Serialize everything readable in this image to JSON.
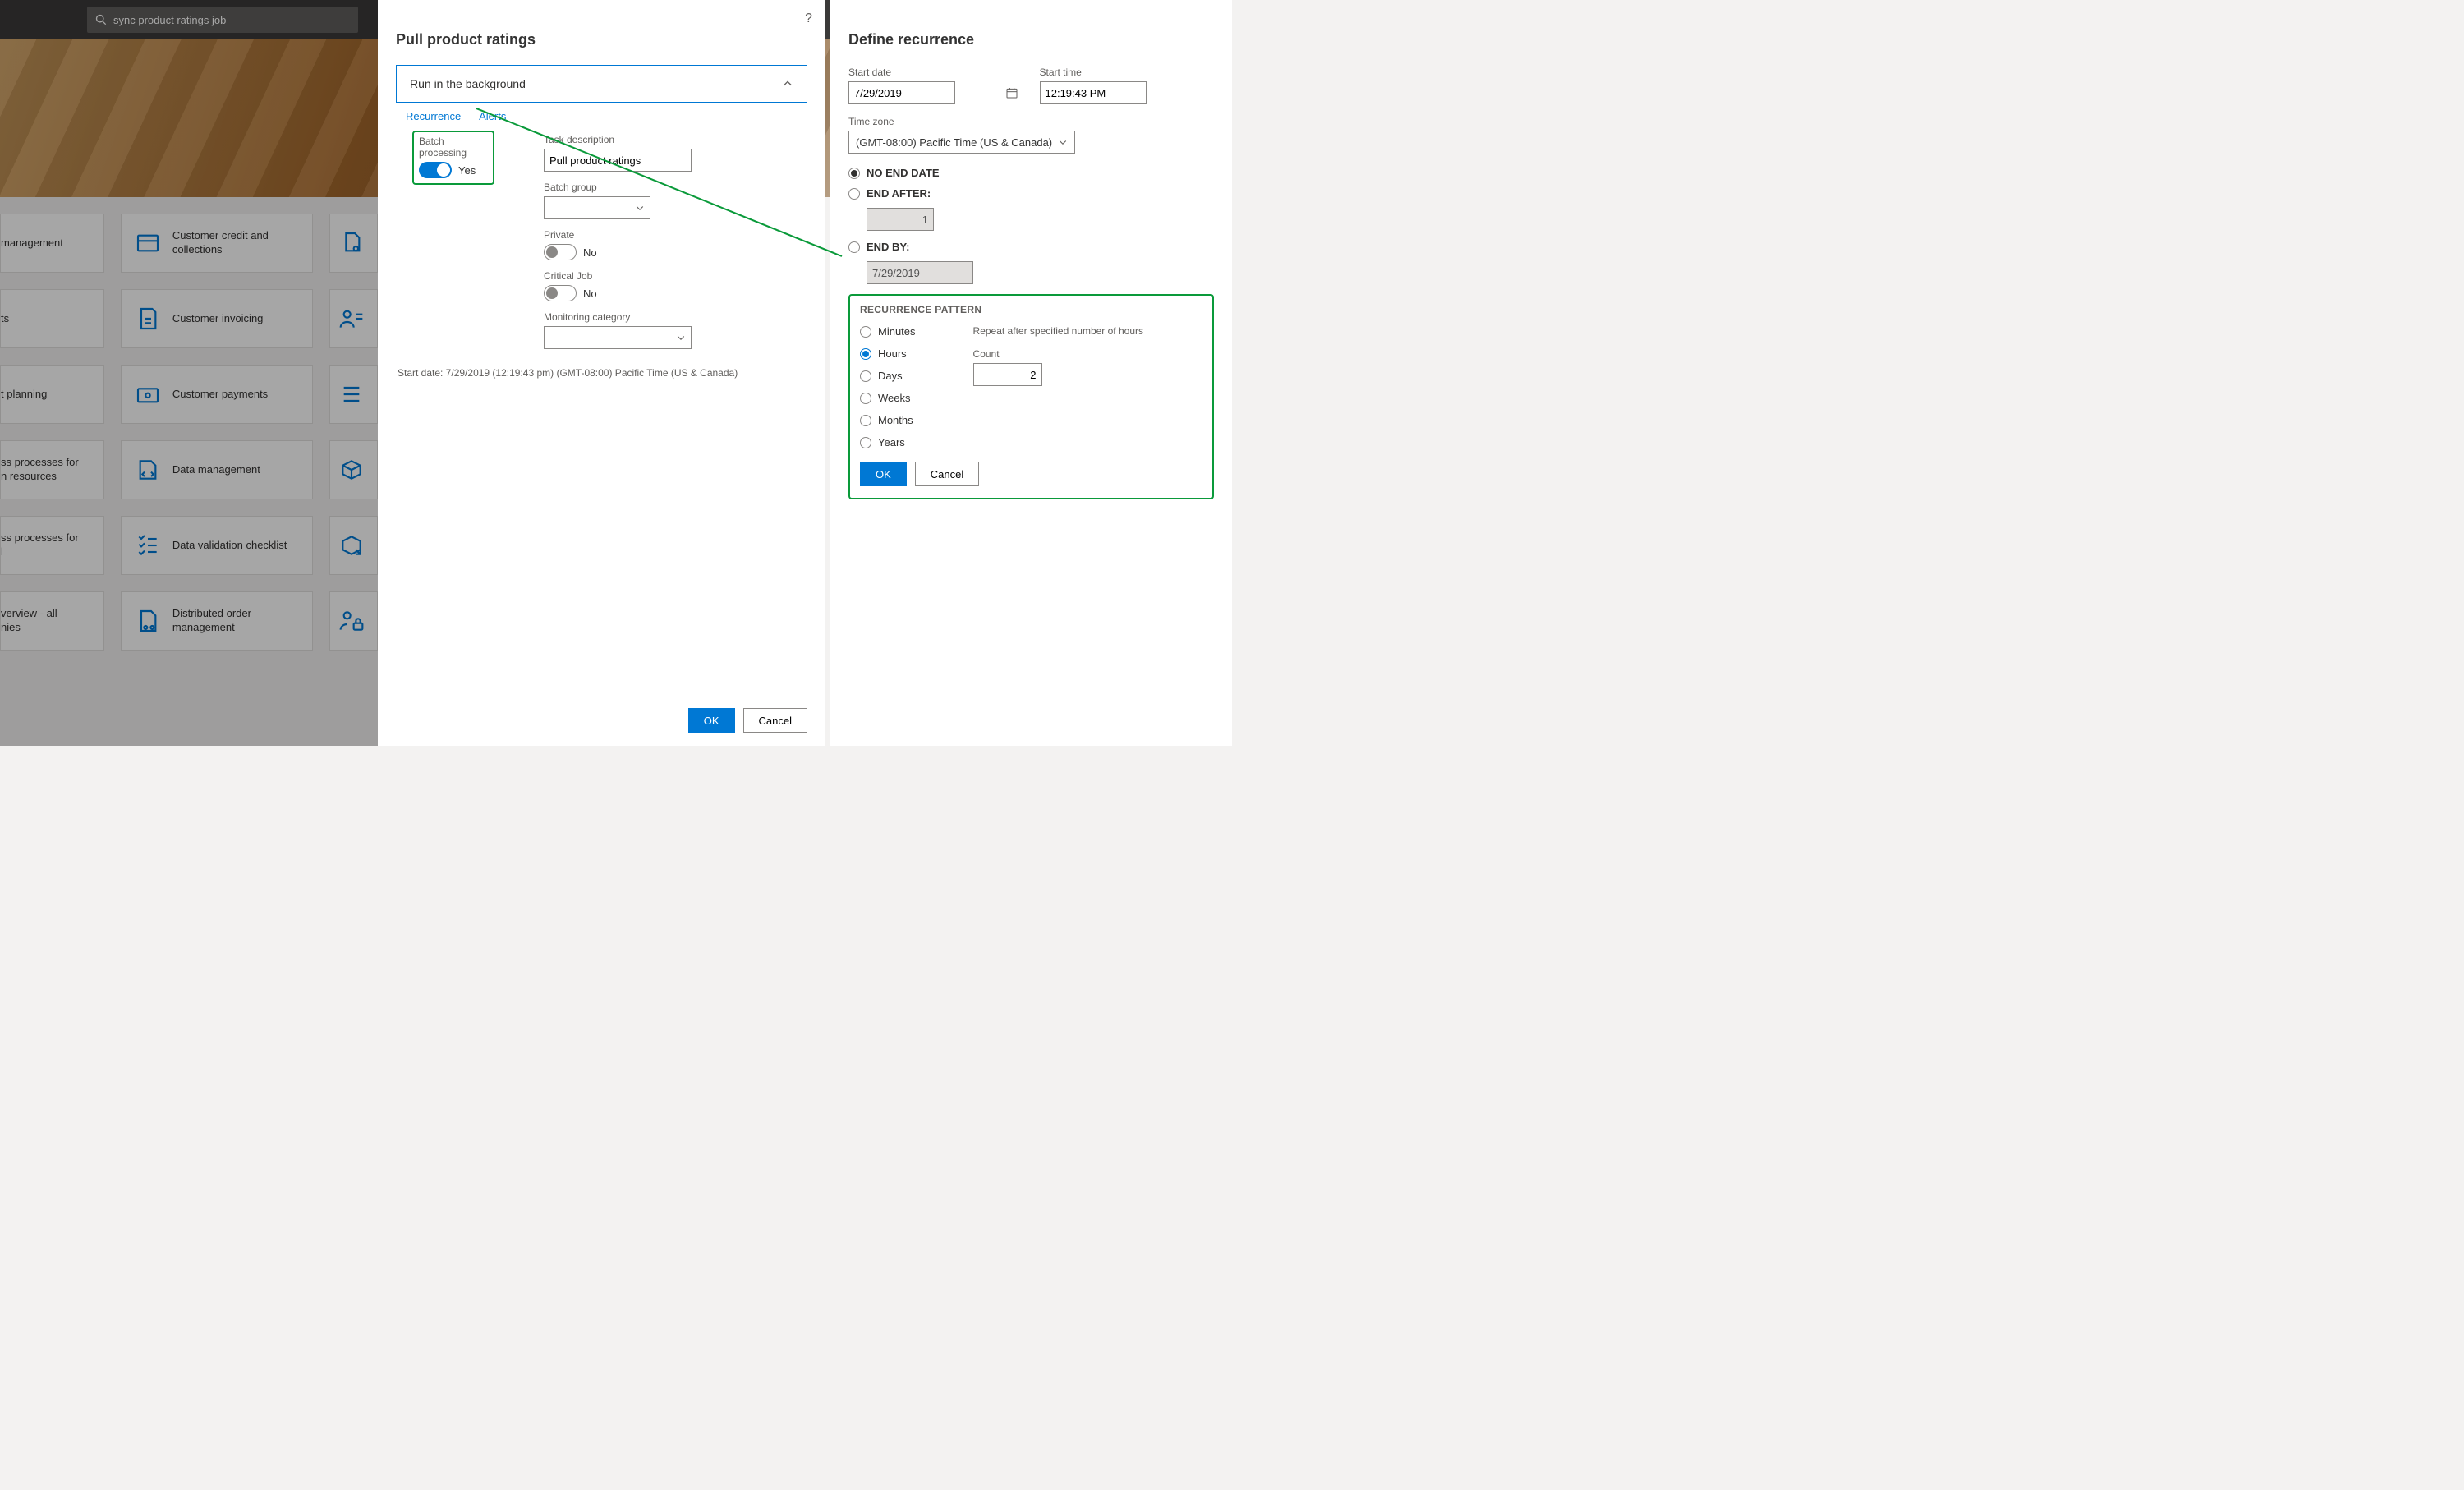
{
  "search": {
    "placeholder": "sync product ratings job"
  },
  "tiles": {
    "left_labels": [
      "management",
      "ts",
      "t planning",
      "ss processes for\nn resources",
      "ss processes for\nl",
      "verview - all\nnies"
    ],
    "center": [
      "Customer credit and collections",
      "Customer invoicing",
      "Customer payments",
      "Data management",
      "Data validation checklist",
      "Distributed order management"
    ]
  },
  "mid": {
    "title": "Pull product ratings",
    "accordion": {
      "title": "Run in the background"
    },
    "sublinks": {
      "recurrence": "Recurrence",
      "alerts": "Alerts"
    },
    "batch_processing": {
      "label": "Batch processing",
      "value": "Yes"
    },
    "task_description": {
      "label": "Task description",
      "value": "Pull product ratings"
    },
    "batch_group": {
      "label": "Batch group",
      "value": ""
    },
    "private": {
      "label": "Private",
      "value": "No"
    },
    "critical": {
      "label": "Critical Job",
      "value": "No"
    },
    "monitoring": {
      "label": "Monitoring category"
    },
    "status_line": "Start date: 7/29/2019 (12:19:43 pm) (GMT-08:00) Pacific Time (US & Canada)",
    "ok": "OK",
    "cancel": "Cancel"
  },
  "right": {
    "title": "Define recurrence",
    "start_date": {
      "label": "Start date",
      "value": "7/29/2019"
    },
    "start_time": {
      "label": "Start time",
      "value": "12:19:43 PM"
    },
    "timezone": {
      "label": "Time zone",
      "value": "(GMT-08:00) Pacific Time (US & Canada)"
    },
    "end_options": {
      "no_end": "NO END DATE",
      "end_after": "END AFTER:",
      "end_after_value": "1",
      "end_by": "END BY:",
      "end_by_value": "7/29/2019",
      "selected": "no_end"
    },
    "pattern": {
      "title": "RECURRENCE PATTERN",
      "hint": "Repeat after specified number of hours",
      "options": [
        "Minutes",
        "Hours",
        "Days",
        "Weeks",
        "Months",
        "Years"
      ],
      "selected": "Hours",
      "count_label": "Count",
      "count_value": "2"
    },
    "ok": "OK",
    "cancel": "Cancel"
  }
}
